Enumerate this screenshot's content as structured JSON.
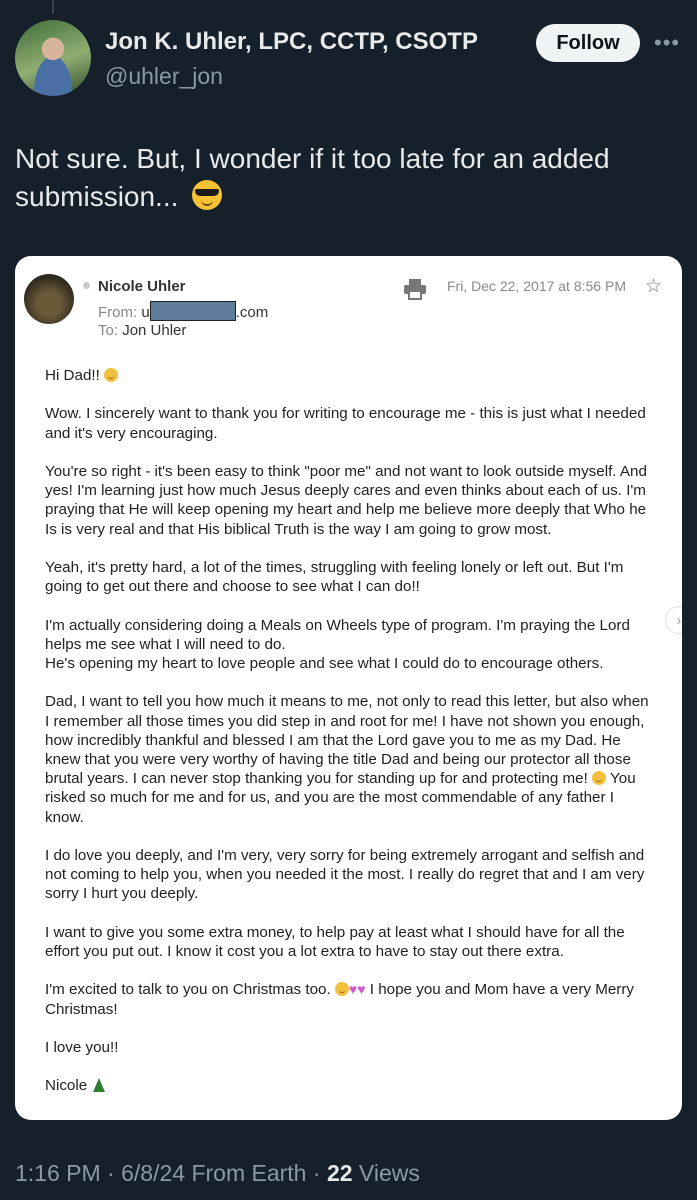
{
  "tweet": {
    "author_name": "Jon K. Uhler, LPC, CCTP, CSOTP",
    "handle": "@uhler_jon",
    "follow_label": "Follow",
    "more_icon": "more-horizontal-icon",
    "text": "Not sure. But, I wonder if it too late for an added submission...",
    "emoji": "smiling-face-with-sunglasses",
    "time": "1:16 PM",
    "date": "6/8/24",
    "source": "From Earth",
    "views_count": "22",
    "views_label": "Views"
  },
  "email": {
    "sender_name": "Nicole Uhler",
    "from_label": "From:",
    "from_prefix": "u",
    "from_suffix": ".com",
    "to_label": "To:",
    "to_value": "Jon Uhler",
    "date": "Fri, Dec 22, 2017 at 8:56 PM",
    "greeting": "Hi Dad!!",
    "p1": "Wow. I sincerely want to thank you for writing to encourage me - this is just what I needed and it's very encouraging.",
    "p2": "You're so right - it's been easy to think \"poor me\" and not want to look outside myself. And yes! I'm learning just how much Jesus deeply cares and even thinks about each of us. I'm praying that He will keep opening my heart and help me believe more deeply that Who he Is is very real and that His biblical Truth is the way I am going to grow most.",
    "p3": "Yeah, it's pretty hard, a lot of the times, struggling with feeling lonely or left out. But I'm going to get out there and choose to see what I can do!!",
    "p4a": "I'm actually considering doing a Meals on Wheels type of program. I'm praying the Lord helps me see what I will need to do.",
    "p4b": "He's opening my heart to love people and see what I could do to encourage others.",
    "p5a": "Dad, I want to tell you how much it means to me, not only to read this letter, but also when I remember all those times you did step in and root for me! I have not shown you enough, how incredibly thankful and blessed I am that the Lord gave you to me as my Dad. He knew that you were very worthy of having the title Dad and being our protector all those brutal years. I can never stop thanking you for standing up for and  protecting me!",
    "p5b": "You risked so much for me and for us, and you are the most commendable of any father I know.",
    "p6": "I do love you deeply, and I'm very, very sorry for being extremely arrogant and selfish and not coming to help you, when you needed it the most. I really do regret that and I am very sorry I hurt you deeply.",
    "p7": "I want to give you some extra money, to help pay at least what I should have for all the effort you put out. I know it cost you a lot extra to have to stay out there extra.",
    "p8a": "I'm excited to talk to you on Christmas too.",
    "p8b": "I hope you and Mom have a very Merry Christmas!",
    "p9": "I love you!!",
    "signature": "Nicole"
  }
}
